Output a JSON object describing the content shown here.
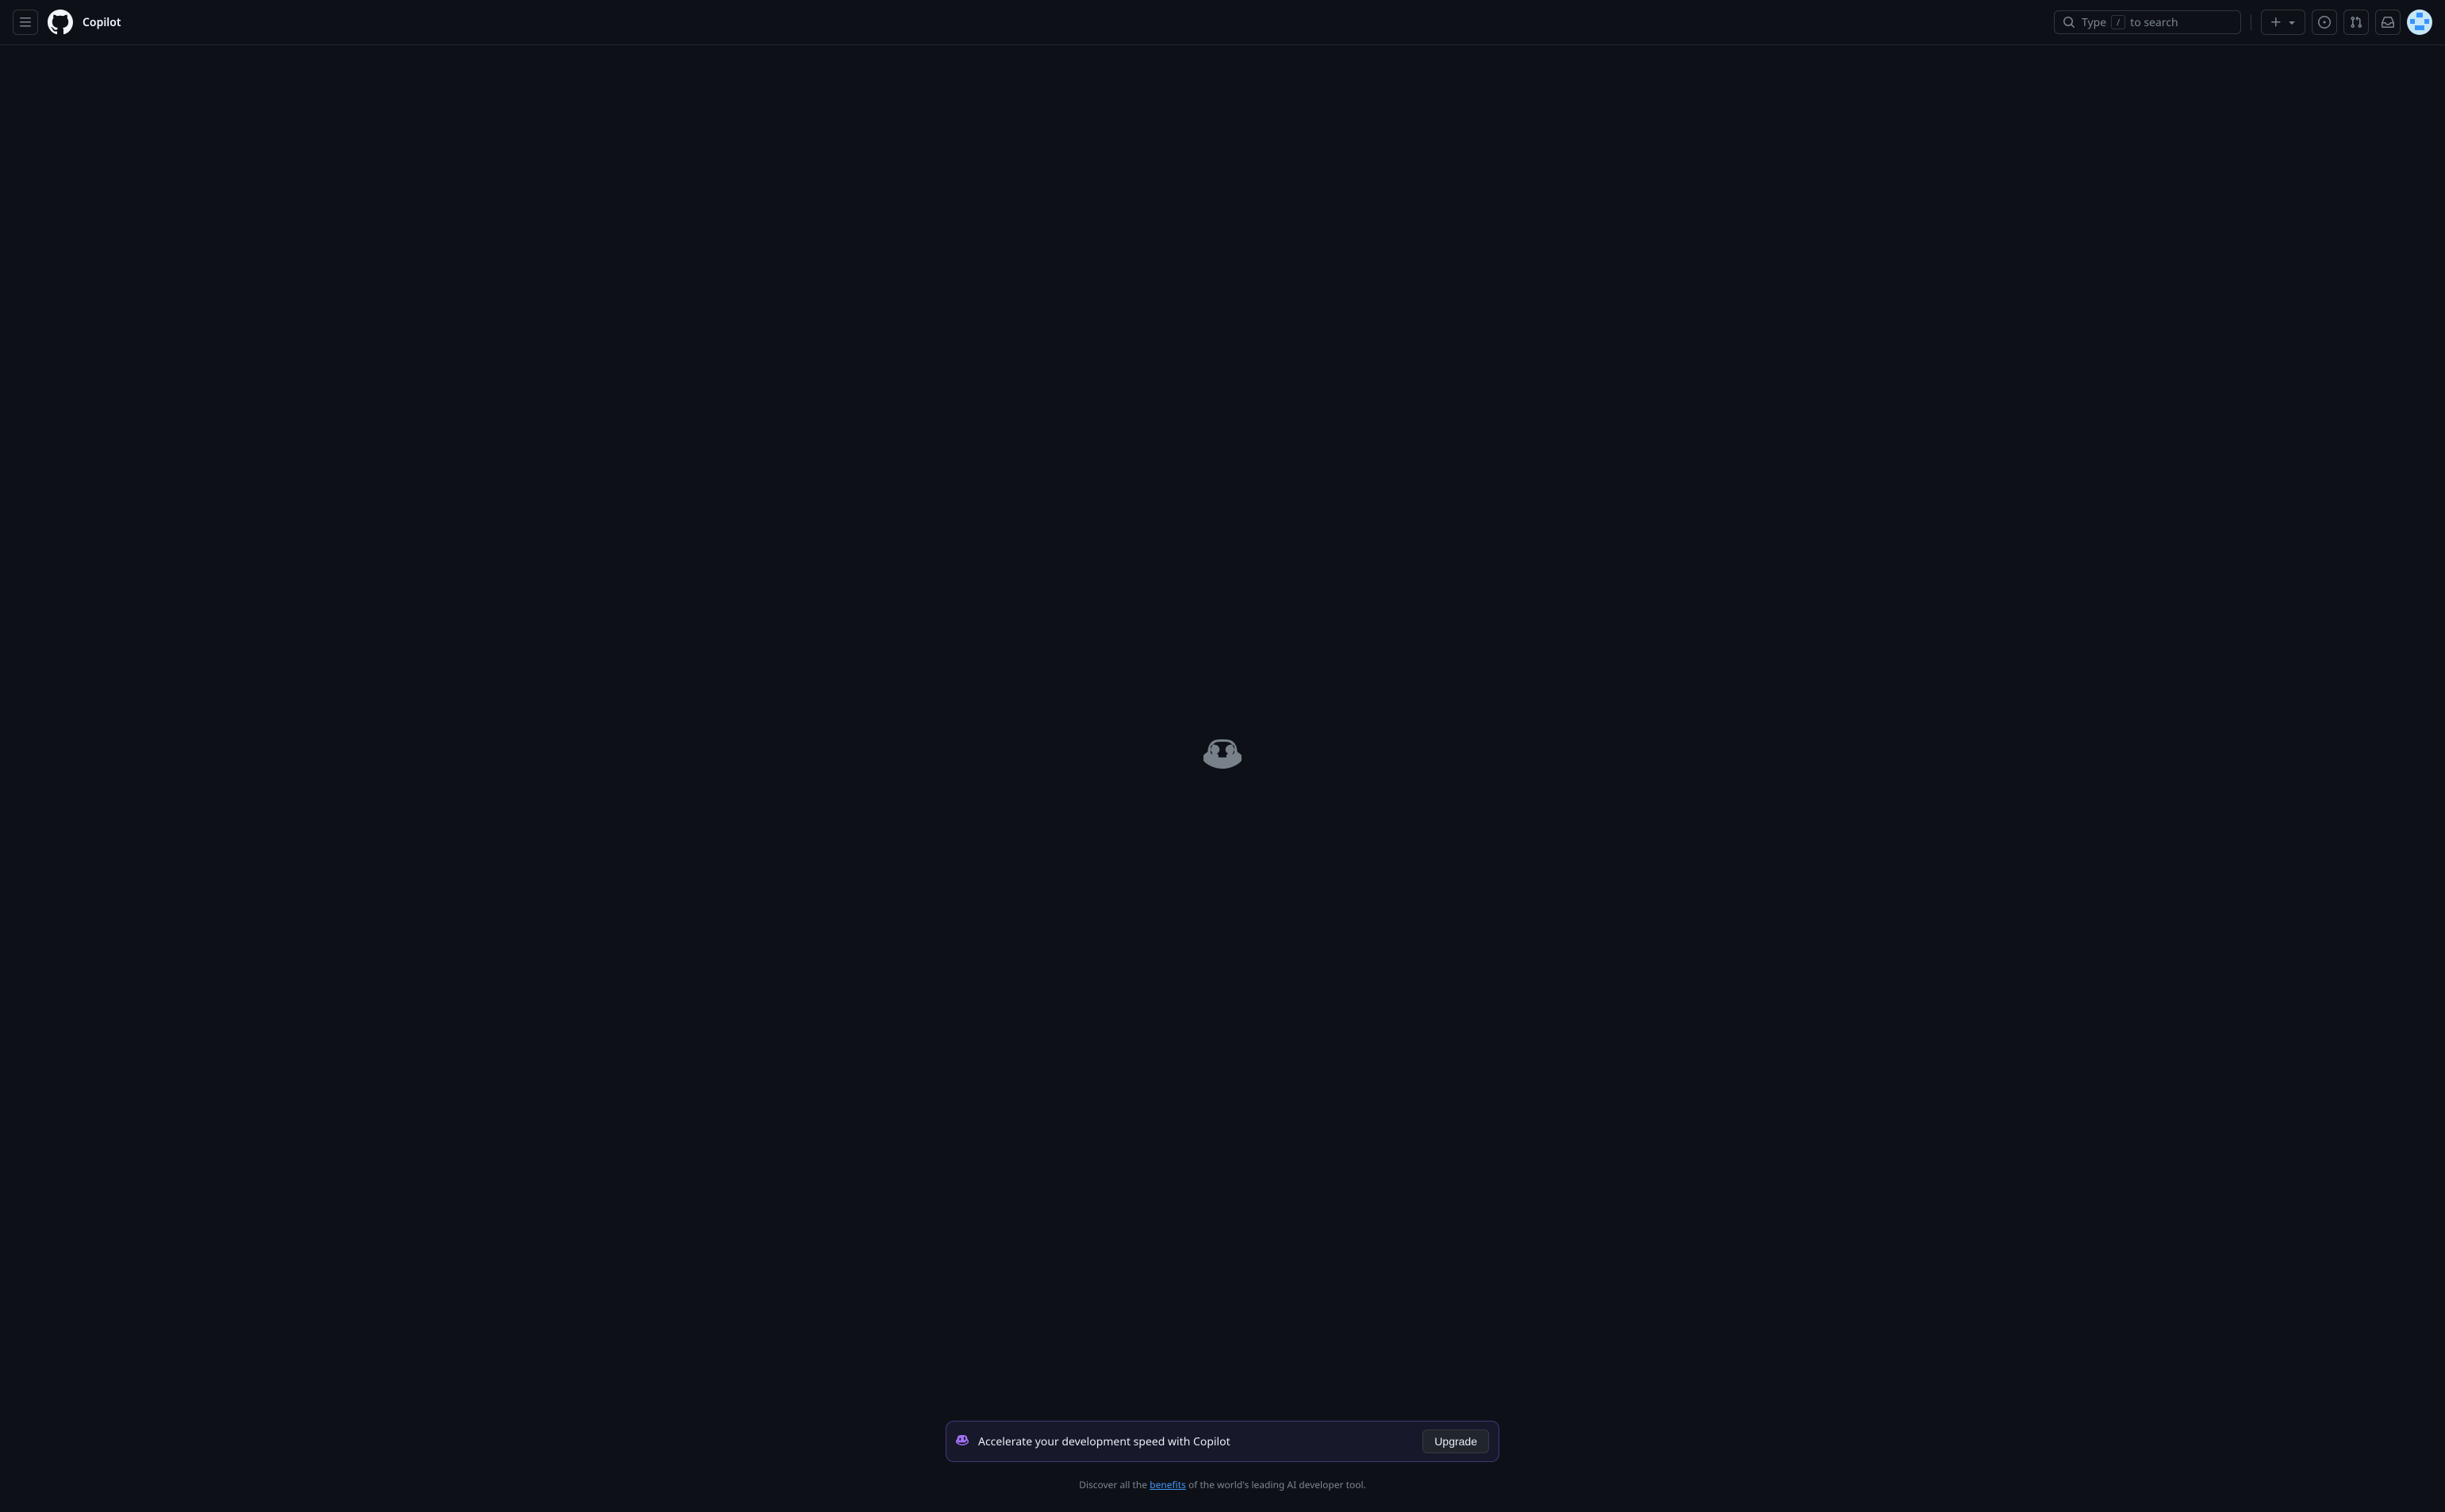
{
  "header": {
    "title": "Copilot",
    "search": {
      "prefix": "Type",
      "key": "/",
      "suffix": "to search"
    }
  },
  "banner": {
    "text": "Accelerate your development speed with Copilot",
    "button": "Upgrade"
  },
  "discover": {
    "prefix": "Discover all the ",
    "link": "benefits",
    "suffix": " of the world's leading AI developer tool."
  }
}
